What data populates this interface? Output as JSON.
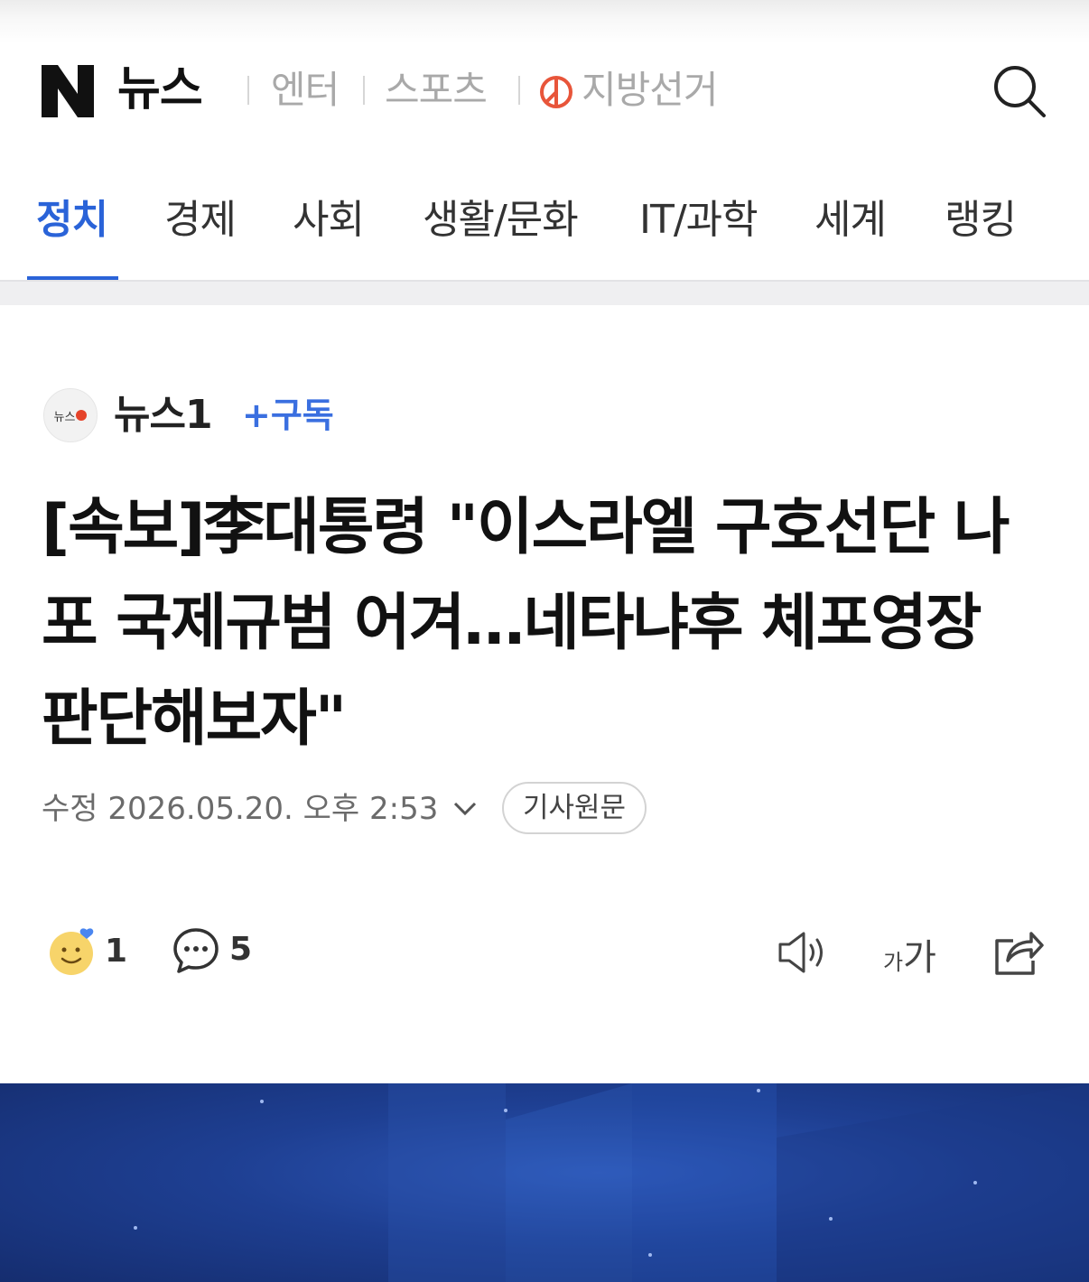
{
  "header": {
    "brand_letter": "N",
    "brand_title": "뉴스",
    "service_links": [
      {
        "label": "엔터"
      },
      {
        "label": "스포츠"
      },
      {
        "label": "지방선거"
      }
    ],
    "election_icon": "vote-mark-icon",
    "search_icon": "search-icon"
  },
  "tabs": [
    {
      "label": "정치",
      "active": true
    },
    {
      "label": "경제"
    },
    {
      "label": "사회"
    },
    {
      "label": "생활/문화"
    },
    {
      "label": "IT/과학"
    },
    {
      "label": "세계"
    },
    {
      "label": "랭킹"
    }
  ],
  "press": {
    "logo_text": "뉴스",
    "name": "뉴스1",
    "subscribe_label": "+구독"
  },
  "article": {
    "headline": "[속보]李대통령 \"이스라엘 구호선단 나포 국제규범 어겨…네타냐후 체포영장 판단해보자\"",
    "updated": "수정 2026.05.20. 오후 2:53",
    "original_label": "기사원문"
  },
  "actions": {
    "reaction_count": "1",
    "comment_count": "5",
    "fontsize_small": "가",
    "fontsize_big": "가"
  },
  "colors": {
    "accent": "#2a63d8",
    "subscribe": "#3a6fe0",
    "election": "#e8553a",
    "hero": "#1e3f92"
  }
}
